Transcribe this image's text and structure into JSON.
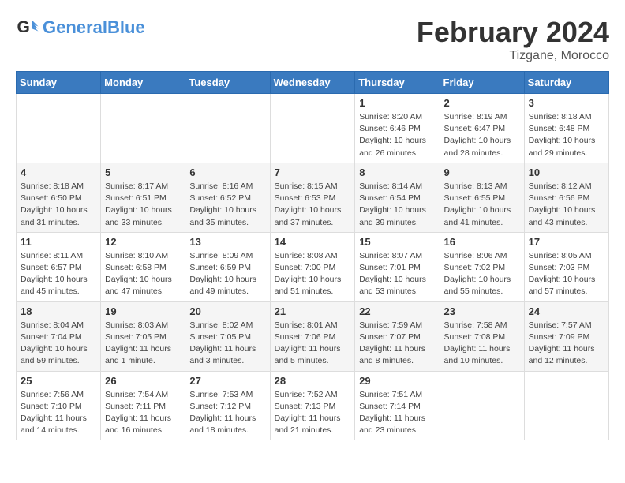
{
  "header": {
    "logo_general": "General",
    "logo_blue": "Blue",
    "month_title": "February 2024",
    "location": "Tizgane, Morocco"
  },
  "days_of_week": [
    "Sunday",
    "Monday",
    "Tuesday",
    "Wednesday",
    "Thursday",
    "Friday",
    "Saturday"
  ],
  "weeks": [
    [
      {
        "day": "",
        "info": ""
      },
      {
        "day": "",
        "info": ""
      },
      {
        "day": "",
        "info": ""
      },
      {
        "day": "",
        "info": ""
      },
      {
        "day": "1",
        "info": "Sunrise: 8:20 AM\nSunset: 6:46 PM\nDaylight: 10 hours\nand 26 minutes."
      },
      {
        "day": "2",
        "info": "Sunrise: 8:19 AM\nSunset: 6:47 PM\nDaylight: 10 hours\nand 28 minutes."
      },
      {
        "day": "3",
        "info": "Sunrise: 8:18 AM\nSunset: 6:48 PM\nDaylight: 10 hours\nand 29 minutes."
      }
    ],
    [
      {
        "day": "4",
        "info": "Sunrise: 8:18 AM\nSunset: 6:50 PM\nDaylight: 10 hours\nand 31 minutes."
      },
      {
        "day": "5",
        "info": "Sunrise: 8:17 AM\nSunset: 6:51 PM\nDaylight: 10 hours\nand 33 minutes."
      },
      {
        "day": "6",
        "info": "Sunrise: 8:16 AM\nSunset: 6:52 PM\nDaylight: 10 hours\nand 35 minutes."
      },
      {
        "day": "7",
        "info": "Sunrise: 8:15 AM\nSunset: 6:53 PM\nDaylight: 10 hours\nand 37 minutes."
      },
      {
        "day": "8",
        "info": "Sunrise: 8:14 AM\nSunset: 6:54 PM\nDaylight: 10 hours\nand 39 minutes."
      },
      {
        "day": "9",
        "info": "Sunrise: 8:13 AM\nSunset: 6:55 PM\nDaylight: 10 hours\nand 41 minutes."
      },
      {
        "day": "10",
        "info": "Sunrise: 8:12 AM\nSunset: 6:56 PM\nDaylight: 10 hours\nand 43 minutes."
      }
    ],
    [
      {
        "day": "11",
        "info": "Sunrise: 8:11 AM\nSunset: 6:57 PM\nDaylight: 10 hours\nand 45 minutes."
      },
      {
        "day": "12",
        "info": "Sunrise: 8:10 AM\nSunset: 6:58 PM\nDaylight: 10 hours\nand 47 minutes."
      },
      {
        "day": "13",
        "info": "Sunrise: 8:09 AM\nSunset: 6:59 PM\nDaylight: 10 hours\nand 49 minutes."
      },
      {
        "day": "14",
        "info": "Sunrise: 8:08 AM\nSunset: 7:00 PM\nDaylight: 10 hours\nand 51 minutes."
      },
      {
        "day": "15",
        "info": "Sunrise: 8:07 AM\nSunset: 7:01 PM\nDaylight: 10 hours\nand 53 minutes."
      },
      {
        "day": "16",
        "info": "Sunrise: 8:06 AM\nSunset: 7:02 PM\nDaylight: 10 hours\nand 55 minutes."
      },
      {
        "day": "17",
        "info": "Sunrise: 8:05 AM\nSunset: 7:03 PM\nDaylight: 10 hours\nand 57 minutes."
      }
    ],
    [
      {
        "day": "18",
        "info": "Sunrise: 8:04 AM\nSunset: 7:04 PM\nDaylight: 10 hours\nand 59 minutes."
      },
      {
        "day": "19",
        "info": "Sunrise: 8:03 AM\nSunset: 7:05 PM\nDaylight: 11 hours\nand 1 minute."
      },
      {
        "day": "20",
        "info": "Sunrise: 8:02 AM\nSunset: 7:05 PM\nDaylight: 11 hours\nand 3 minutes."
      },
      {
        "day": "21",
        "info": "Sunrise: 8:01 AM\nSunset: 7:06 PM\nDaylight: 11 hours\nand 5 minutes."
      },
      {
        "day": "22",
        "info": "Sunrise: 7:59 AM\nSunset: 7:07 PM\nDaylight: 11 hours\nand 8 minutes."
      },
      {
        "day": "23",
        "info": "Sunrise: 7:58 AM\nSunset: 7:08 PM\nDaylight: 11 hours\nand 10 minutes."
      },
      {
        "day": "24",
        "info": "Sunrise: 7:57 AM\nSunset: 7:09 PM\nDaylight: 11 hours\nand 12 minutes."
      }
    ],
    [
      {
        "day": "25",
        "info": "Sunrise: 7:56 AM\nSunset: 7:10 PM\nDaylight: 11 hours\nand 14 minutes."
      },
      {
        "day": "26",
        "info": "Sunrise: 7:54 AM\nSunset: 7:11 PM\nDaylight: 11 hours\nand 16 minutes."
      },
      {
        "day": "27",
        "info": "Sunrise: 7:53 AM\nSunset: 7:12 PM\nDaylight: 11 hours\nand 18 minutes."
      },
      {
        "day": "28",
        "info": "Sunrise: 7:52 AM\nSunset: 7:13 PM\nDaylight: 11 hours\nand 21 minutes."
      },
      {
        "day": "29",
        "info": "Sunrise: 7:51 AM\nSunset: 7:14 PM\nDaylight: 11 hours\nand 23 minutes."
      },
      {
        "day": "",
        "info": ""
      },
      {
        "day": "",
        "info": ""
      }
    ]
  ]
}
